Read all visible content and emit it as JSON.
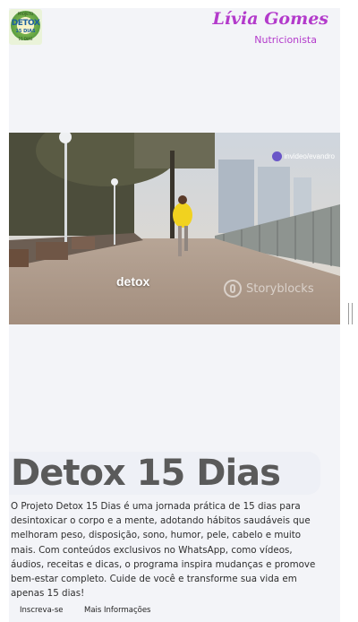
{
  "header": {
    "logo": {
      "top_text": "PROJETO",
      "main_text": "DETOX",
      "sub_text": "15 DIAS",
      "bottom_text": "15 DIAS"
    },
    "brand_name": "Lívia Gomes",
    "brand_role": "Nutricionista"
  },
  "video": {
    "caption": "detox",
    "credit": "invideo/evandro",
    "watermark": "Storyblocks"
  },
  "main": {
    "title": "Detox 15 Dias",
    "description": "O Projeto Detox 15 Dias é uma jornada prática de 15 dias para desintoxicar o corpo e a mente, adotando hábitos saudáveis que melhoram peso, disposição, sono, humor, pele, cabelo e muito mais. Com conteúdos exclusivos no WhatsApp, como vídeos, áudios, receitas e dicas, o programa inspira mudanças e promove bem-estar completo. Cuide de você e transforme sua vida em apenas 15 dias!"
  },
  "actions": {
    "subscribe_label": "Inscreva-se",
    "more_info_label": "Mais Informações"
  },
  "colors": {
    "brand": "#b33acb",
    "title": "#5a5a5a",
    "page_bg": "#f3f4f8"
  }
}
